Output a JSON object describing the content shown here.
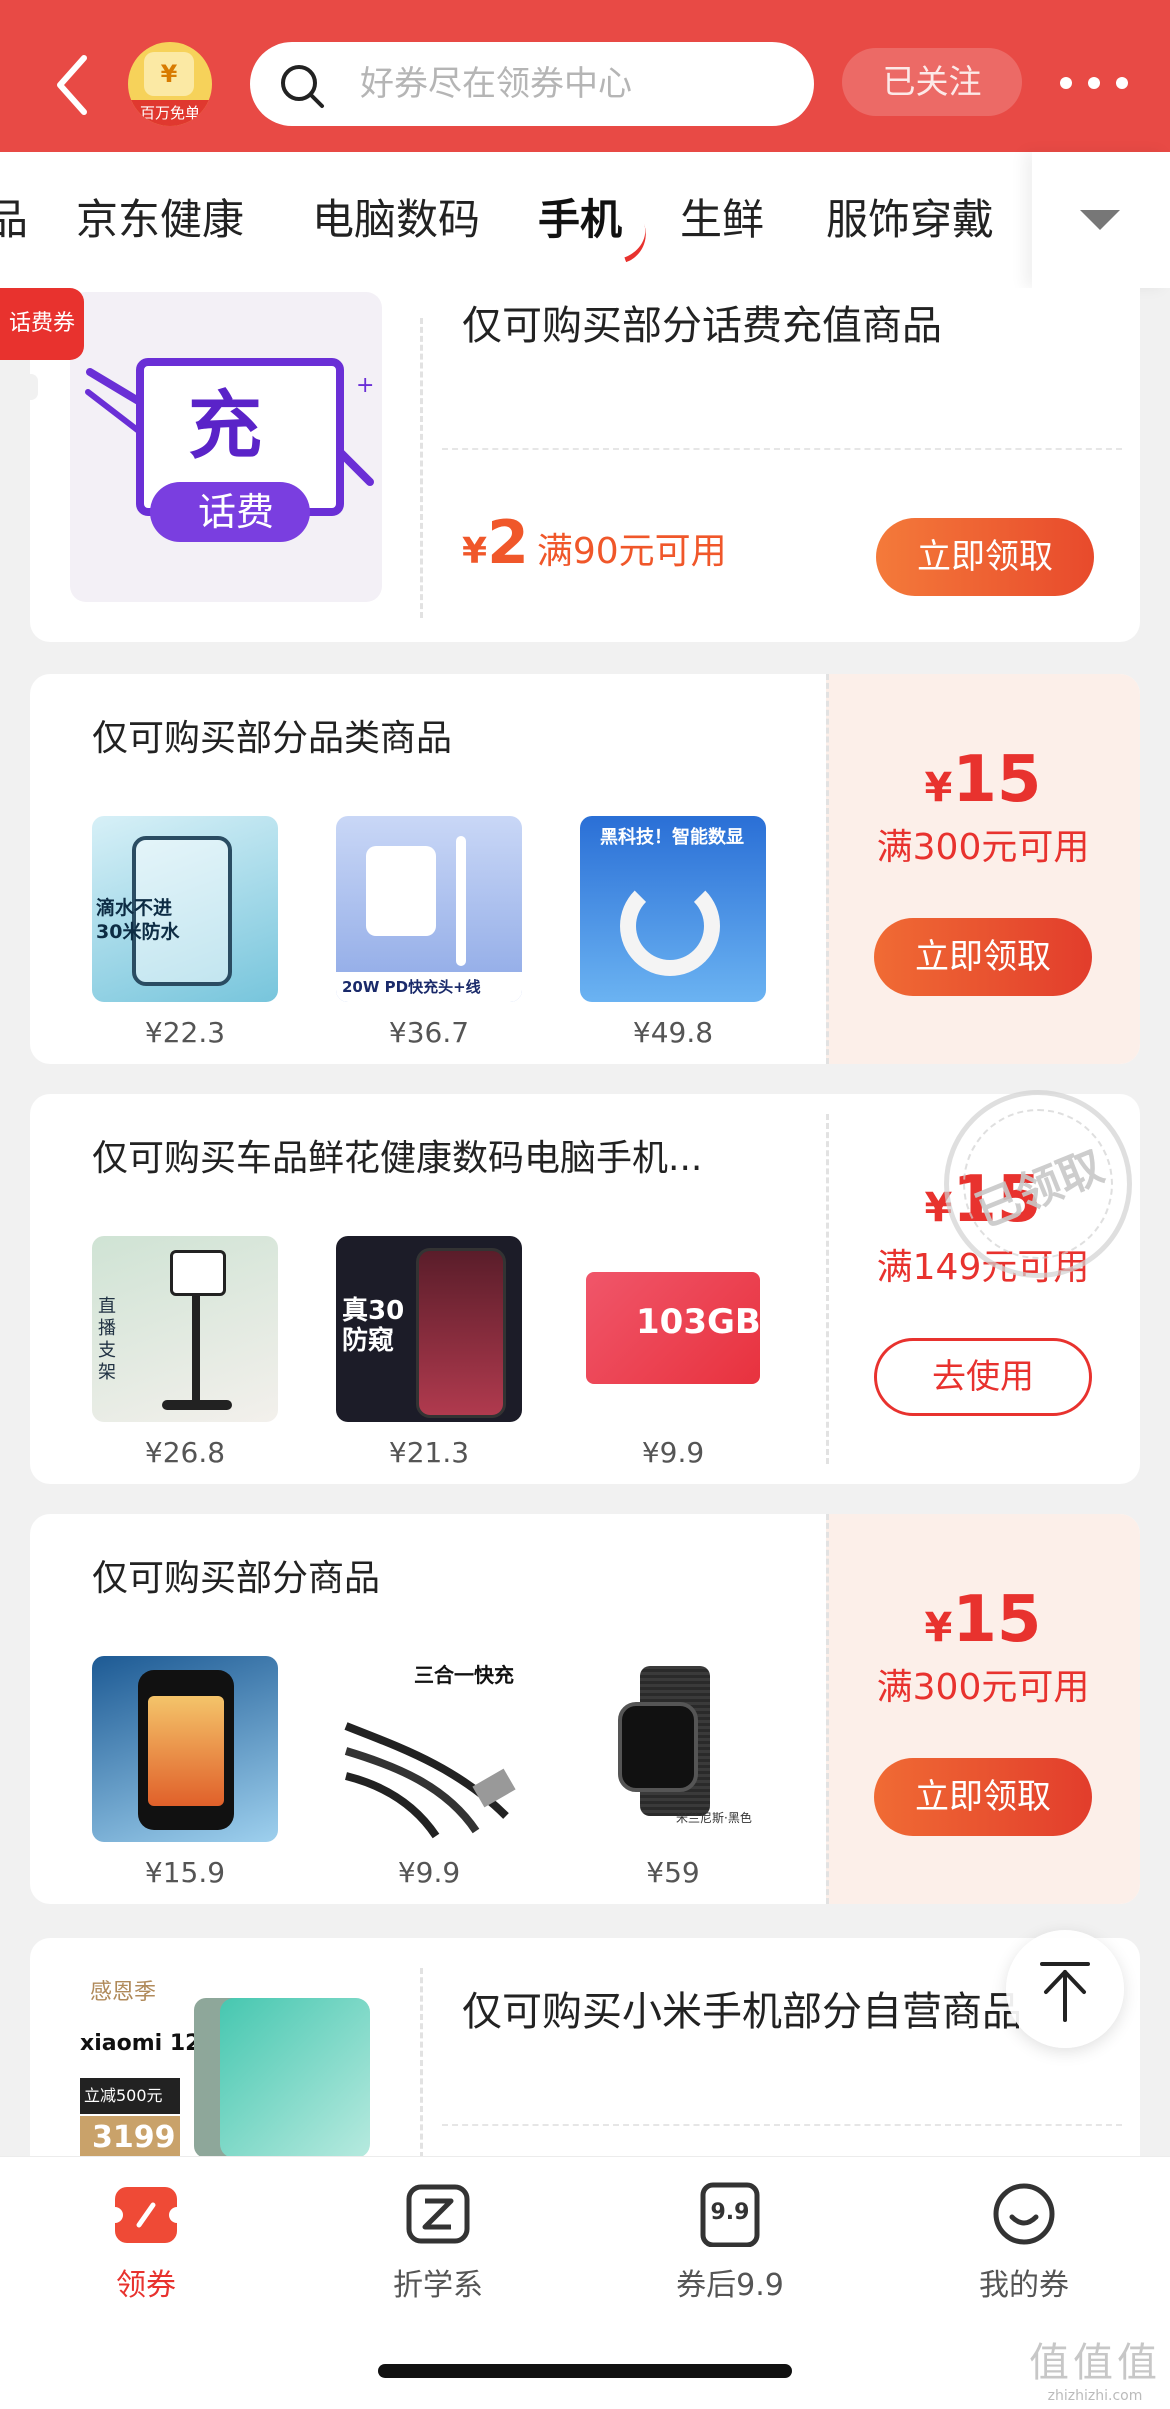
{
  "header": {
    "badge_label": "百万免单",
    "badge_coin": "¥",
    "search_placeholder": "好券尽在领券中心",
    "follow_label": "已关注"
  },
  "tabs": [
    {
      "label": "品"
    },
    {
      "label": "京东健康"
    },
    {
      "label": "电脑数码"
    },
    {
      "label": "手机",
      "active": true
    },
    {
      "label": "生鲜"
    },
    {
      "label": "服饰穿戴"
    }
  ],
  "coupons": [
    {
      "tag": "话费券",
      "image_main": "充",
      "image_sub": "话费",
      "title": "仅可购买部分话费充值商品",
      "symbol": "¥",
      "amount": "2",
      "condition": "满90元可用",
      "button": "立即领取"
    },
    {
      "title": "仅可购买部分品类商品",
      "symbol": "¥",
      "amount": "15",
      "condition": "满300元可用",
      "button": "立即领取",
      "products": [
        {
          "price": "¥22.3",
          "text": "滴水不进\n30米防水"
        },
        {
          "price": "¥36.7",
          "text": "20W PD快充头+线"
        },
        {
          "price": "¥49.8",
          "text": "黑科技！智能数显"
        }
      ]
    },
    {
      "title": "仅可购买车品鲜花健康数码电脑手机...",
      "symbol": "¥",
      "amount": "15",
      "condition": "满149元可用",
      "button": "去使用",
      "stamp": "已领取",
      "products": [
        {
          "price": "¥26.8",
          "text": "直播支架"
        },
        {
          "price": "¥21.3",
          "text": "真30 防窥"
        },
        {
          "price": "¥9.9",
          "text": "103GB"
        }
      ]
    },
    {
      "title": "仅可购买部分商品",
      "symbol": "¥",
      "amount": "15",
      "condition": "满300元可用",
      "button": "立即领取",
      "products": [
        {
          "price": "¥15.9",
          "text": ""
        },
        {
          "price": "¥9.9",
          "text": "三合一快充"
        },
        {
          "price": "¥59",
          "text": "米兰尼斯·黑色"
        }
      ]
    },
    {
      "title": "仅可购买小米手机部分自营商品",
      "image_brand": "xiaomi 12",
      "image_season": "感恩季",
      "image_price": "3199",
      "image_discount": "立减500元"
    }
  ],
  "bottom_nav": [
    {
      "label": "领券",
      "icon": "coupon-icon",
      "active": true
    },
    {
      "label": "折学系",
      "icon": "z-logo-icon"
    },
    {
      "label": "券后9.9",
      "icon": "price-tag-icon",
      "badge": "9.9"
    },
    {
      "label": "我的券",
      "icon": "smile-icon"
    }
  ],
  "watermark": {
    "main": "值值值",
    "sub": "zhizhizhi.com"
  },
  "colors": {
    "brand_red": "#e84a45",
    "accent": "#e8322e",
    "orange": "#f47a3a"
  }
}
